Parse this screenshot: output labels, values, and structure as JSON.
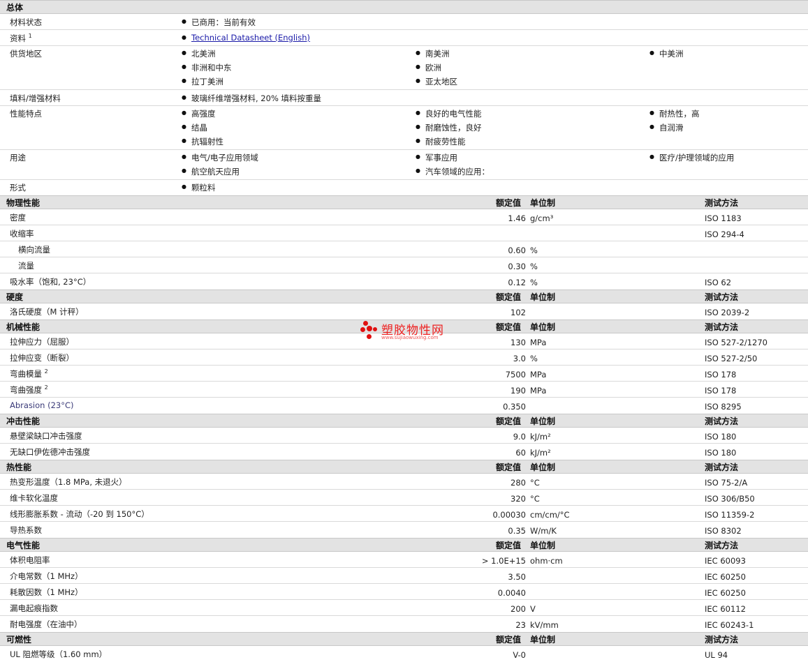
{
  "general": {
    "title": "总体",
    "rows": [
      {
        "label": "材料状态",
        "items": [
          "已商用：当前有效"
        ]
      },
      {
        "label": "资料",
        "sup": "1",
        "link": "Technical Datasheet (English)"
      },
      {
        "label": "供货地区",
        "items": [
          "北美洲",
          "南美洲",
          "中美洲",
          "非洲和中东",
          "欧洲",
          "拉丁美洲",
          "亚太地区"
        ]
      },
      {
        "label": "填料/增强材料",
        "items": [
          "玻璃纤维增强材料, 20% 填料按重量"
        ]
      },
      {
        "label": "性能特点",
        "items": [
          "高强度",
          "良好的电气性能",
          "耐热性，高",
          "结晶",
          "耐磨蚀性，良好",
          "自润滑",
          "抗辐射性",
          "耐疲劳性能"
        ]
      },
      {
        "label": "用途",
        "items": [
          "电气/电子应用领域",
          "军事应用",
          "医疗/护理领域的应用",
          "航空航天应用",
          "汽车领域的应用："
        ]
      },
      {
        "label": "形式",
        "items": [
          "颗粒料"
        ]
      }
    ]
  },
  "headers": {
    "value": "额定值",
    "unit": "单位制",
    "method": "测试方法"
  },
  "sections": [
    {
      "title": "物理性能",
      "rows": [
        {
          "label": "密度",
          "value": "1.46",
          "unit": "g/cm³",
          "method": "ISO 1183"
        },
        {
          "label": "收缩率",
          "value": "",
          "unit": "",
          "method": "ISO 294-4"
        },
        {
          "label": "横向流量",
          "indent": true,
          "value": "0.60",
          "unit": "%",
          "method": ""
        },
        {
          "label": "流量",
          "indent": true,
          "value": "0.30",
          "unit": "%",
          "method": ""
        },
        {
          "label": "吸水率（饱和, 23°C）",
          "value": "0.12",
          "unit": "%",
          "method": "ISO 62"
        }
      ]
    },
    {
      "title": "硬度",
      "rows": [
        {
          "label": "洛氏硬度（M 计秤）",
          "value": "102",
          "unit": "",
          "method": "ISO 2039-2"
        }
      ]
    },
    {
      "title": "机械性能",
      "rows": [
        {
          "label": "拉伸应力（屈服）",
          "value": "130",
          "unit": "MPa",
          "method": "ISO 527-2/1270"
        },
        {
          "label": "拉伸应变（断裂）",
          "value": "3.0",
          "unit": "%",
          "method": "ISO 527-2/50"
        },
        {
          "label": "弯曲模量",
          "sup": "2",
          "value": "7500",
          "unit": "MPa",
          "method": "ISO 178"
        },
        {
          "label": "弯曲强度",
          "sup": "2",
          "value": "190",
          "unit": "MPa",
          "method": "ISO 178"
        },
        {
          "label": "Abrasion (23°C)",
          "en": true,
          "value": "0.350",
          "unit": "",
          "method": "ISO 8295"
        }
      ]
    },
    {
      "title": "冲击性能",
      "rows": [
        {
          "label": "悬壁梁缺口冲击强度",
          "value": "9.0",
          "unit": "kJ/m²",
          "method": "ISO 180"
        },
        {
          "label": "无缺口伊佐德冲击强度",
          "value": "60",
          "unit": "kJ/m²",
          "method": "ISO 180"
        }
      ]
    },
    {
      "title": "热性能",
      "rows": [
        {
          "label": "热变形温度（1.8 MPa, 未退火）",
          "value": "280",
          "unit": "°C",
          "method": "ISO 75-2/A"
        },
        {
          "label": "维卡软化温度",
          "value": "320",
          "unit": "°C",
          "method": "ISO 306/B50"
        },
        {
          "label": "线形膨胀系数 - 流动（-20 到  150°C）",
          "value": "0.00030",
          "unit": "cm/cm/°C",
          "method": "ISO 11359-2"
        },
        {
          "label": "导热系数",
          "value": "0.35",
          "unit": "W/m/K",
          "method": "ISO 8302"
        }
      ]
    },
    {
      "title": "电气性能",
      "rows": [
        {
          "label": "体积电阻率",
          "value": "> 1.0E+15",
          "unit": "ohm·cm",
          "method": "IEC 60093"
        },
        {
          "label": "介电常数（1 MHz）",
          "value": "3.50",
          "unit": "",
          "method": "IEC 60250"
        },
        {
          "label": "耗散因数（1 MHz）",
          "value": "0.0040",
          "unit": "",
          "method": "IEC 60250"
        },
        {
          "label": "漏电起痕指数",
          "value": "200",
          "unit": "V",
          "method": "IEC 60112"
        },
        {
          "label": "耐电强度（在油中）",
          "value": "23",
          "unit": "kV/mm",
          "method": "IEC 60243-1"
        }
      ]
    },
    {
      "title": "可燃性",
      "rows": [
        {
          "label": "UL 阻燃等级（1.60 mm）",
          "value": "V-0",
          "unit": "",
          "method": "UL 94"
        }
      ]
    }
  ],
  "watermark": {
    "name": "塑胶物性网",
    "url": "www.sujiaowuxing.com"
  }
}
